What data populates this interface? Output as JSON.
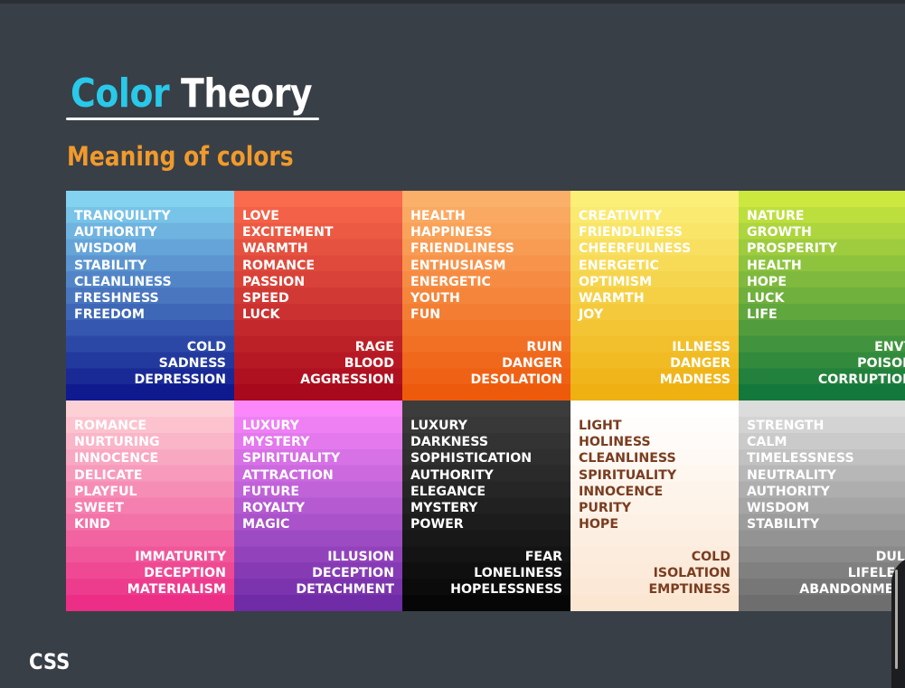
{
  "slide": {
    "title_part1": "Color",
    "title_part2": "Theory",
    "subtitle": "Meaning of colors",
    "footer_label": "CSS"
  },
  "colors": [
    {
      "id": "blue",
      "gradient": [
        "#82d2f0",
        "#0f1a8e"
      ],
      "text_color": "#ffffff",
      "positive": [
        "TRANQUILITY",
        "AUTHORITY",
        "WISDOM",
        "STABILITY",
        "CLEANLINESS",
        "FRESHNESS",
        "FREEDOM"
      ],
      "negative": [
        "COLD",
        "SADNESS",
        "DEPRESSION"
      ]
    },
    {
      "id": "red",
      "gradient": [
        "#fa6a4c",
        "#a8091c"
      ],
      "text_color": "#ffffff",
      "positive": [
        "LOVE",
        "EXCITEMENT",
        "WARMTH",
        "ROMANCE",
        "PASSION",
        "SPEED",
        "LUCK"
      ],
      "negative": [
        "RAGE",
        "BLOOD",
        "AGGRESSION"
      ]
    },
    {
      "id": "orange",
      "gradient": [
        "#fbb06a",
        "#ee5a0c"
      ],
      "text_color": "#ffffff",
      "positive": [
        "HEALTH",
        "HAPPINESS",
        "FRIENDLINESS",
        "ENTHUSIASM",
        "ENERGETIC",
        "YOUTH",
        "FUN"
      ],
      "negative": [
        "RUIN",
        "DANGER",
        "DESOLATION"
      ]
    },
    {
      "id": "yellow",
      "gradient": [
        "#fbef78",
        "#efb012"
      ],
      "text_color": "#ffffff",
      "positive": [
        "CREATIVITY",
        "FRIENDLINESS",
        "CHEERFULNESS",
        "ENERGETIC",
        "OPTIMISM",
        "WARMTH",
        "JOY"
      ],
      "negative": [
        "ILLNESS",
        "DANGER",
        "MADNESS"
      ]
    },
    {
      "id": "green",
      "gradient": [
        "#cce83e",
        "#13783c"
      ],
      "text_color": "#ffffff",
      "positive": [
        "NATURE",
        "GROWTH",
        "PROSPERITY",
        "HEALTH",
        "HOPE",
        "LUCK",
        "LIFE"
      ],
      "negative": [
        "ENVY",
        "POISON",
        "CORRUPTION"
      ]
    },
    {
      "id": "pink",
      "gradient": [
        "#fdd0d6",
        "#ec2e86"
      ],
      "text_color": "#ffffff",
      "positive": [
        "ROMANCE",
        "NURTURING",
        "INNOCENCE",
        "DELICATE",
        "PLAYFUL",
        "SWEET",
        "KIND"
      ],
      "negative": [
        "IMMATURITY",
        "DECEPTION",
        "MATERIALISM"
      ]
    },
    {
      "id": "purple",
      "gradient": [
        "#fa88fb",
        "#6f2ca6"
      ],
      "text_color": "#ffffff",
      "positive": [
        "LUXURY",
        "MYSTERY",
        "SPIRITUALITY",
        "ATTRACTION",
        "FUTURE",
        "ROYALTY",
        "MAGIC"
      ],
      "negative": [
        "ILLUSION",
        "DECEPTION",
        "DETACHMENT"
      ]
    },
    {
      "id": "black",
      "gradient": [
        "#3c3c3c",
        "#060606"
      ],
      "text_color": "#ffffff",
      "positive": [
        "LUXURY",
        "DARKNESS",
        "SOPHISTICATION",
        "AUTHORITY",
        "ELEGANCE",
        "MYSTERY",
        "POWER"
      ],
      "negative": [
        "FEAR",
        "LONELINESS",
        "HOPELESSNESS"
      ]
    },
    {
      "id": "white",
      "gradient": [
        "#ffffff",
        "#fbe6d2"
      ],
      "text_color": "#7a3d20",
      "positive": [
        "LIGHT",
        "HOLINESS",
        "CLEANLINESS",
        "SPIRITUALITY",
        "INNOCENCE",
        "PURITY",
        "HOPE"
      ],
      "negative": [
        "COLD",
        "ISOLATION",
        "EMPTINESS"
      ]
    },
    {
      "id": "gray",
      "gradient": [
        "#dcdcdc",
        "#6e6e6e"
      ],
      "text_color": "#ffffff",
      "positive": [
        "STRENGTH",
        "CALM",
        "TIMELESSNESS",
        "NEUTRALITY",
        "AUTHORITY",
        "WISDOM",
        "STABILITY"
      ],
      "negative": [
        "DULL",
        "LIFELESS",
        "ABANDONMENT"
      ]
    }
  ]
}
